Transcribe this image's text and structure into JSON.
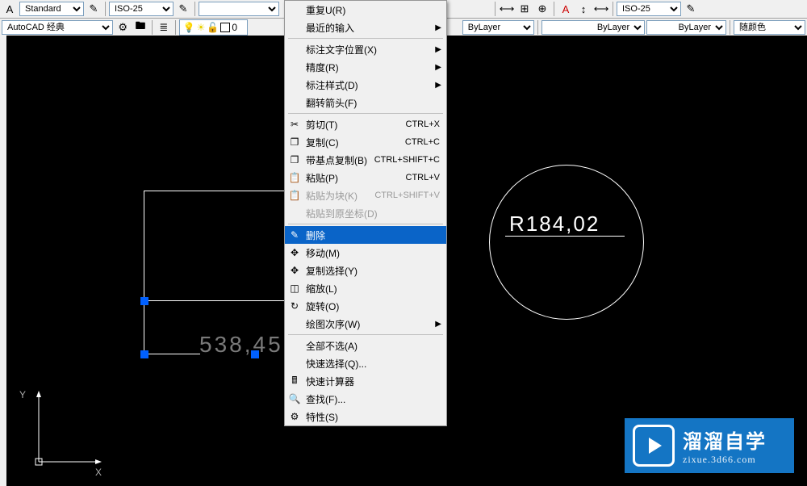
{
  "toolbar1": {
    "text_style": "Standard",
    "dim_style": "ISO-25",
    "dim_style2": "ISO-25",
    "empty": ""
  },
  "toolbar2": {
    "workspace": "AutoCAD 经典",
    "layer_name": "0",
    "bylayer": "ByLayer",
    "suiyanse": "随颜色"
  },
  "menu": {
    "repeat": "重复U(R)",
    "recent": "最近的输入",
    "dim_text_pos": "标注文字位置(X)",
    "precision": "精度(R)",
    "dim_style": "标注样式(D)",
    "flip_arrow": "翻转箭头(F)",
    "cut": "剪切(T)",
    "cut_sc": "CTRL+X",
    "copy": "复制(C)",
    "copy_sc": "CTRL+C",
    "copy_base": "带基点复制(B)",
    "copy_base_sc": "CTRL+SHIFT+C",
    "paste": "粘贴(P)",
    "paste_sc": "CTRL+V",
    "paste_block": "粘贴为块(K)",
    "paste_block_sc": "CTRL+SHIFT+V",
    "paste_orig": "粘贴到原坐标(D)",
    "delete": "删除",
    "move": "移动(M)",
    "copy_sel": "复制选择(Y)",
    "scale": "缩放(L)",
    "rotate": "旋转(O)",
    "draw_order": "绘图次序(W)",
    "deselect": "全部不选(A)",
    "quick_sel": "快速选择(Q)...",
    "quick_calc": "快速计算器",
    "find": "查找(F)...",
    "properties": "特性(S)"
  },
  "canvas": {
    "dim1": "538,45",
    "dim2": "R184,02",
    "axis_x": "X",
    "axis_y": "Y"
  },
  "watermark": {
    "brand": "溜溜自学",
    "url": "zixue.3d66.com"
  }
}
